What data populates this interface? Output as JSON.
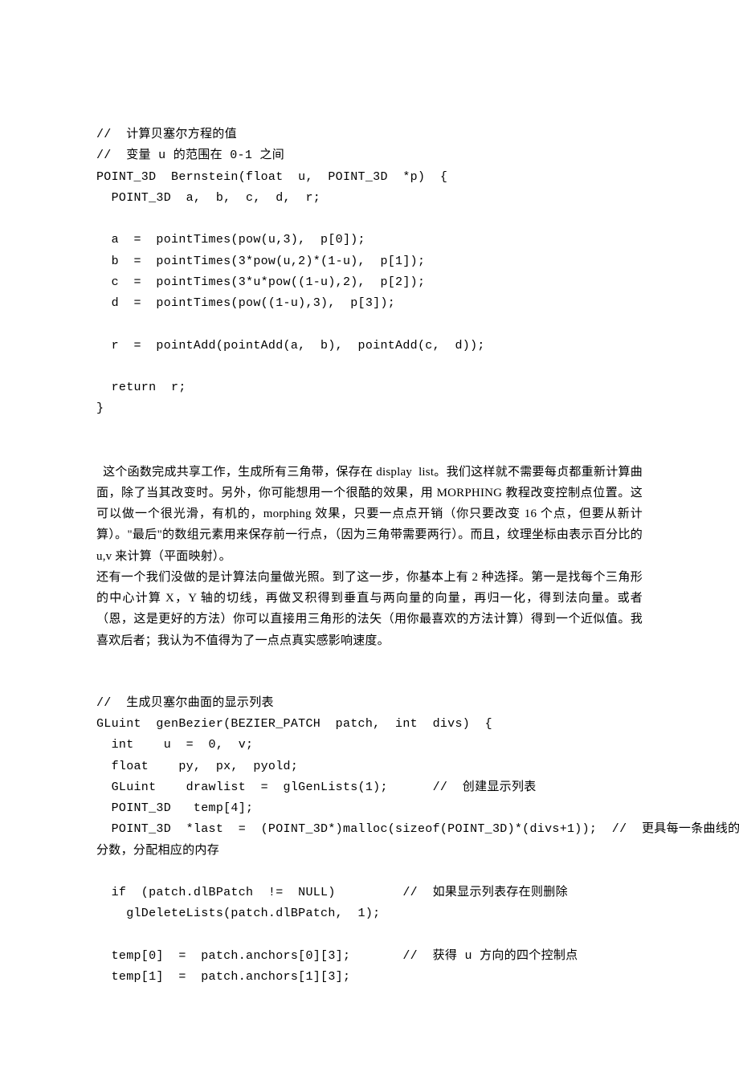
{
  "code1": "//  计算贝塞尔方程的值\n//  变量 u 的范围在 0-1 之间\nPOINT_3D  Bernstein(float  u,  POINT_3D  *p)  {\n  POINT_3D  a,  b,  c,  d,  r;\n\n  a  =  pointTimes(pow(u,3),  p[0]);\n  b  =  pointTimes(3*pow(u,2)*(1-u),  p[1]);\n  c  =  pointTimes(3*u*pow((1-u),2),  p[2]);\n  d  =  pointTimes(pow((1-u),3),  p[3]);\n\n  r  =  pointAdd(pointAdd(a,  b),  pointAdd(c,  d));\n\n  return  r;\n}",
  "prose1": "  这个函数完成共享工作，生成所有三角带，保存在 display  list。我们这样就不需要每贞都重新计算曲面，除了当其改变时。另外，你可能想用一个很酷的效果，用 MORPHING 教程改变控制点位置。这可以做一个很光滑，有机的，morphing 效果，只要一点点开销（你只要改变 16 个点，但要从新计算）。\"最后\"的数组元素用来保存前一行点，（因为三角带需要两行）。而且，纹理坐标由表示百分比的 u,v 来计算（平面映射）。",
  "prose2": "还有一个我们没做的是计算法向量做光照。到了这一步，你基本上有 2 种选择。第一是找每个三角形的中心计算 X，Y 轴的切线，再做叉积得到垂直与两向量的向量，再归一化，得到法向量。或者（恩，这是更好的方法）你可以直接用三角形的法矢（用你最喜欢的方法计算）得到一个近似值。我喜欢后者；我认为不值得为了一点点真实感影响速度。",
  "code2": "//  生成贝塞尔曲面的显示列表\nGLuint  genBezier(BEZIER_PATCH  patch,  int  divs)  {\n  int    u  =  0,  v;\n  float    py,  px,  pyold;\n  GLuint    drawlist  =  glGenLists(1);      //  创建显示列表\n  POINT_3D   temp[4];\n  POINT_3D  *last  =  (POINT_3D*)malloc(sizeof(POINT_3D)*(divs+1));  //  更具每一条曲线的细\n分数，分配相应的内存\n\n  if  (patch.dlBPatch  !=  NULL)         //  如果显示列表存在则删除\n    glDeleteLists(patch.dlBPatch,  1);\n\n  temp[0]  =  patch.anchors[0][3];       //  获得 u 方向的四个控制点\n  temp[1]  =  patch.anchors[1][3];"
}
